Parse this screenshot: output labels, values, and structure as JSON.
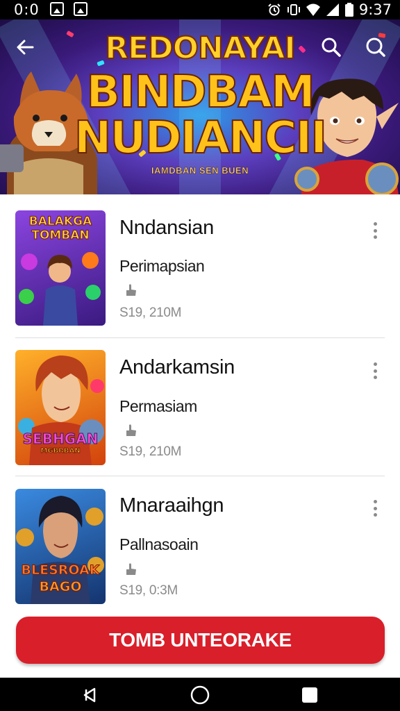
{
  "status_bar": {
    "time_left": "0:0",
    "time_right": "9:37",
    "icons": [
      "image-notification-icon",
      "gallery-notification-icon",
      "alarm-icon",
      "vibrate-icon",
      "wifi-icon",
      "signal-icon",
      "battery-icon"
    ]
  },
  "banner": {
    "title_top": "REDONAYAI",
    "title_line1": "BINDBAM",
    "title_line2": "NUDIANCII",
    "subtitle": "IAMDBAN SEN BUEN",
    "icons": [
      "back-arrow-icon",
      "search-icon",
      "search-icon"
    ]
  },
  "games": [
    {
      "title": "Nndansian",
      "subtitle": "Perimapsian",
      "size": "S19, 210M",
      "thumb_line1": "BALAKGA",
      "thumb_line2": "TOMBAN",
      "thumb_colors": [
        "#7b3fd0",
        "#3b1a7a"
      ]
    },
    {
      "title": "Andarkamsin",
      "subtitle": "Permasiam",
      "size": "S19, 210M",
      "thumb_line1": "SEBHGAN",
      "thumb_line2": "MGBRBAN",
      "thumb_colors": [
        "#ff9a1a",
        "#c23a0a"
      ]
    },
    {
      "title": "Mnaraaihgn",
      "subtitle": "Pallnasoain",
      "size": "S19, 0:3M",
      "thumb_line1": "BLESROAK",
      "thumb_line2": "BAGO",
      "thumb_colors": [
        "#2f7fd8",
        "#123a7a"
      ]
    }
  ],
  "action_button": {
    "label": "TOMB UNTEORAKE",
    "color": "#d91f2a"
  },
  "nav_bar": {
    "icons": [
      "back-triangle-icon",
      "home-circle-icon",
      "recents-square-icon"
    ]
  }
}
